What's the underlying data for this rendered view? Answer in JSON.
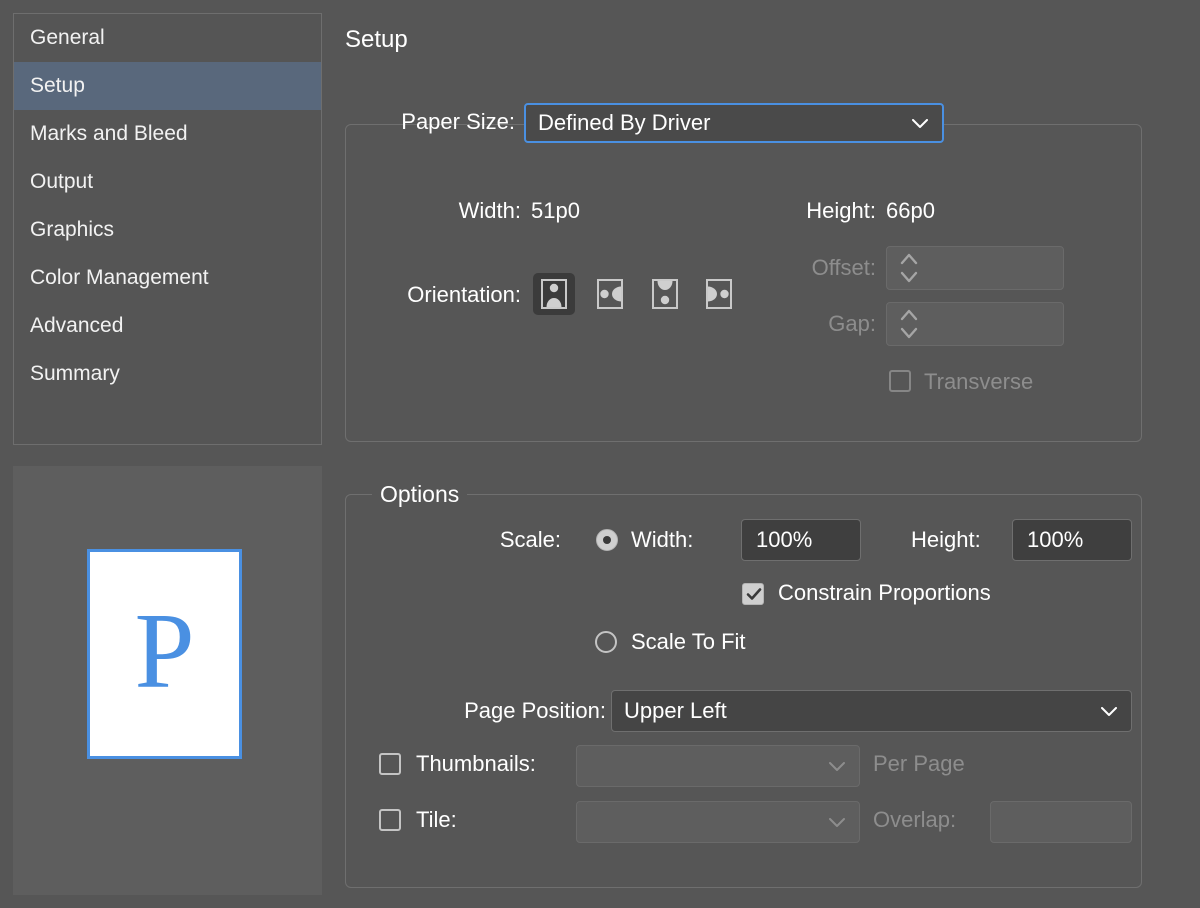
{
  "sidebar": {
    "items": [
      {
        "label": "General",
        "selected": false
      },
      {
        "label": "Setup",
        "selected": true
      },
      {
        "label": "Marks and Bleed",
        "selected": false
      },
      {
        "label": "Output",
        "selected": false
      },
      {
        "label": "Graphics",
        "selected": false
      },
      {
        "label": "Color Management",
        "selected": false
      },
      {
        "label": "Advanced",
        "selected": false
      },
      {
        "label": "Summary",
        "selected": false
      }
    ]
  },
  "preview": {
    "page_letter": "P",
    "page_border_color": "#4a90e2",
    "page_fill_color": "#ffffff"
  },
  "main": {
    "title": "Setup",
    "paper": {
      "legend": "",
      "paper_size_label": "Paper Size:",
      "paper_size_value": "Defined By Driver",
      "width_label": "Width:",
      "width_value": "51p0",
      "height_label": "Height:",
      "height_value": "66p0",
      "orientation_label": "Orientation:",
      "orientations": [
        {
          "name": "portrait",
          "selected": true
        },
        {
          "name": "landscape",
          "selected": false
        },
        {
          "name": "reverse-portrait",
          "selected": false
        },
        {
          "name": "reverse-landscape",
          "selected": false
        }
      ],
      "offset_label": "Offset:",
      "offset_value": "",
      "gap_label": "Gap:",
      "gap_value": "",
      "transverse_label": "Transverse",
      "transverse_checked": false
    },
    "options": {
      "legend": "Options",
      "scale_label": "Scale:",
      "scale_radio_selected": true,
      "scale_width_label": "Width:",
      "scale_width_value": "100%",
      "scale_height_label": "Height:",
      "scale_height_value": "100%",
      "constrain_label": "Constrain Proportions",
      "constrain_checked": true,
      "scale_to_fit_label": "Scale To Fit",
      "scale_to_fit_selected": false,
      "page_position_label": "Page Position:",
      "page_position_value": "Upper Left",
      "thumbnails_label": "Thumbnails:",
      "thumbnails_checked": false,
      "thumbnails_value": "",
      "per_page_label": "Per Page",
      "tile_label": "Tile:",
      "tile_checked": false,
      "tile_value": "",
      "overlap_label": "Overlap:",
      "overlap_value": ""
    }
  },
  "colors": {
    "window_bg": "#565656",
    "selection_blue": "#59687c",
    "accent_blue": "#4a90e2",
    "field_bg": "#3f3f3f",
    "disabled_text": "#8d8d8d"
  }
}
